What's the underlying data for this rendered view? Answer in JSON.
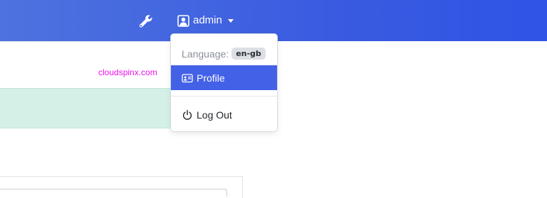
{
  "header": {
    "admin_icon": "wrench-icon",
    "user_icon": "user-icon",
    "username": "admin"
  },
  "content": {
    "watermark": "cloudspinx.com"
  },
  "user_menu": {
    "language_label": "Language:",
    "language_value": "en-gb",
    "items": [
      {
        "label": "Profile",
        "icon": "id-card-icon",
        "active": true
      },
      {
        "label": "Log Out",
        "icon": "power-icon",
        "active": false
      }
    ]
  },
  "colors": {
    "header_gradient_start": "#4e73df",
    "header_gradient_end": "#2f54e6",
    "active_item": "#4361e6",
    "alert_background": "#d5f0e7",
    "watermark": "#e812e8"
  }
}
